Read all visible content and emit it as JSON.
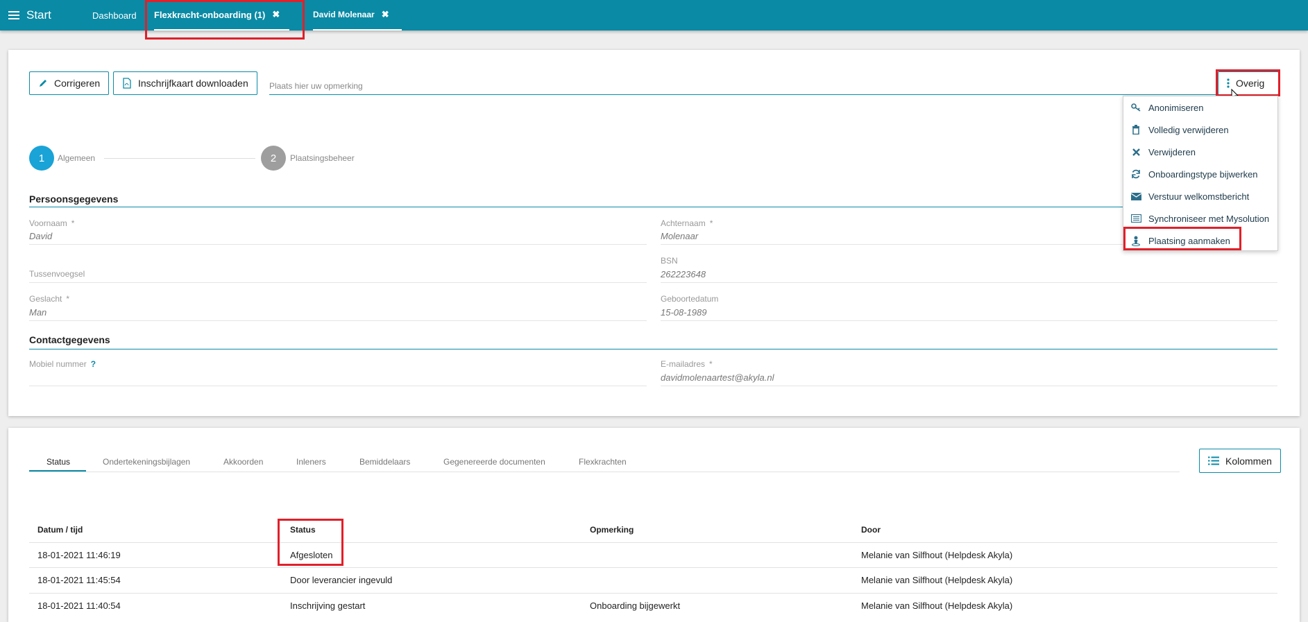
{
  "topbar": {
    "start_label": "Start",
    "tabs": [
      {
        "label": "Dashboard"
      },
      {
        "label": "Flexkracht-onboarding (1)"
      },
      {
        "label": "David Molenaar"
      }
    ],
    "close_glyph": "✖"
  },
  "toolbar": {
    "correct_label": "Corrigeren",
    "download_label": "Inschrijfkaart downloaden",
    "remark_placeholder": "Plaats hier uw opmerking",
    "other_label": "Overig"
  },
  "dropdown": {
    "items": [
      {
        "label": "Anonimiseren",
        "icon": "key-icon"
      },
      {
        "label": "Volledig verwijderen",
        "icon": "trash-icon"
      },
      {
        "label": "Verwijderen",
        "icon": "close-icon"
      },
      {
        "label": "Onboardingstype bijwerken",
        "icon": "refresh-icon"
      },
      {
        "label": "Verstuur welkomstbericht",
        "icon": "envelope-icon"
      },
      {
        "label": "Synchroniseer met Mysolution",
        "icon": "list-icon"
      },
      {
        "label": "Plaatsing aanmaken",
        "icon": "person-pin-icon"
      }
    ]
  },
  "steps": [
    {
      "number": "1",
      "label": "Algemeen"
    },
    {
      "number": "2",
      "label": "Plaatsingsbeheer"
    }
  ],
  "persons": {
    "title": "Persoonsgegevens",
    "fields": {
      "voornaam_label": "Voornaam",
      "voornaam": "David",
      "achternaam_label": "Achternaam",
      "achternaam": "Molenaar",
      "tussenvoegsel_label": "Tussenvoegsel",
      "bsn_label": "BSN",
      "bsn": "262223648",
      "geslacht_label": "Geslacht",
      "geslacht": "Man",
      "geboortedatum_label": "Geboortedatum",
      "geboortedatum": "15-08-1989"
    }
  },
  "contact": {
    "title": "Contactgegevens",
    "mobiel_label": "Mobiel nummer",
    "email_label": "E-mailadres",
    "email": "davidmolenaartest@akyla.nl"
  },
  "required_mark": "*",
  "help_mark": "?",
  "lower_tabs": [
    "Status",
    "Ondertekeningsbijlagen",
    "Akkoorden",
    "Inleners",
    "Bemiddelaars",
    "Gegenereerde documenten",
    "Flexkrachten"
  ],
  "columns_button": "Kolommen",
  "table": {
    "headers": [
      "Datum / tijd",
      "Status",
      "Opmerking",
      "Door"
    ],
    "rows": [
      [
        "18-01-2021 11:46:19",
        "Afgesloten",
        "",
        "Melanie van Silfhout (Helpdesk Akyla)"
      ],
      [
        "18-01-2021 11:45:54",
        "Door leverancier ingevuld",
        "",
        "Melanie van Silfhout (Helpdesk Akyla)"
      ],
      [
        "18-01-2021 11:40:54",
        "Inschrijving gestart",
        "Onboarding bijgewerkt",
        "Melanie van Silfhout (Helpdesk Akyla)"
      ]
    ]
  },
  "colors": {
    "brand": "#0a8aa5",
    "step_active": "#1aa3d6",
    "step_inactive": "#9e9e9e",
    "highlight": "#e0202a"
  }
}
